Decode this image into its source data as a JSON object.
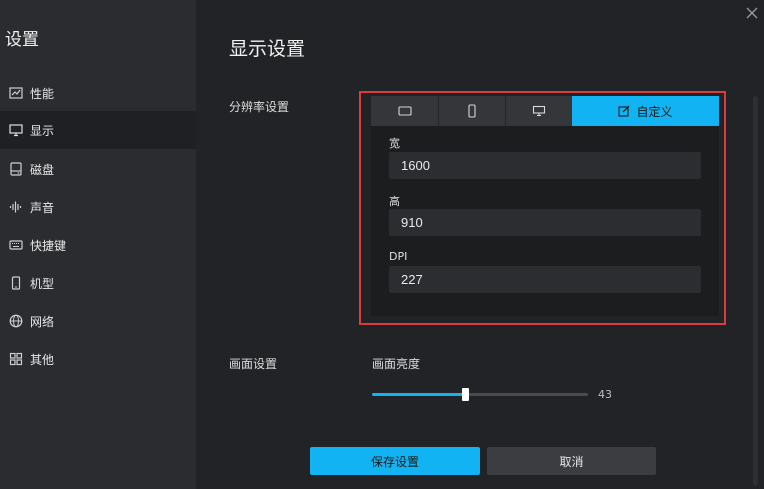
{
  "sidebar": {
    "title": "设置",
    "items": [
      {
        "label": "性能",
        "icon": "chart-icon"
      },
      {
        "label": "显示",
        "icon": "monitor-icon"
      },
      {
        "label": "磁盘",
        "icon": "disk-icon"
      },
      {
        "label": "声音",
        "icon": "sound-wave-icon"
      },
      {
        "label": "快捷键",
        "icon": "keyboard-icon"
      },
      {
        "label": "机型",
        "icon": "phone-icon"
      },
      {
        "label": "网络",
        "icon": "globe-icon"
      },
      {
        "label": "其他",
        "icon": "grid-icon"
      }
    ]
  },
  "main": {
    "title": "显示设置",
    "resolution": {
      "label": "分辨率设置",
      "tabs": [
        {
          "icon": "tablet-landscape-icon",
          "label": ""
        },
        {
          "icon": "phone-portrait-icon",
          "label": ""
        },
        {
          "icon": "desktop-icon",
          "label": ""
        },
        {
          "icon": "edit-icon",
          "label": "自定义"
        }
      ],
      "fields": [
        {
          "label": "宽",
          "value": "1600"
        },
        {
          "label": "高",
          "value": "910"
        },
        {
          "label": "DPI",
          "value": "227"
        }
      ]
    },
    "display": {
      "label": "画面设置",
      "brightness_label": "画面亮度",
      "brightness_value": "43",
      "brightness_fraction": 0.43
    },
    "buttons": {
      "save": "保存设置",
      "cancel": "取消"
    }
  },
  "colors": {
    "accent": "#12b3f2",
    "highlight_border": "#d93c3c",
    "background": "#222326",
    "sidebar": "#2b2c30"
  }
}
